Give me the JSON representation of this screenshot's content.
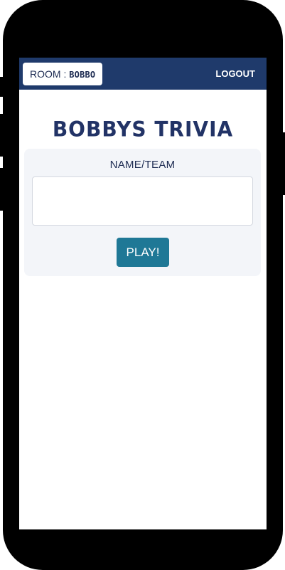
{
  "header": {
    "room_label": "ROOM : ",
    "room_code": "BOBBO",
    "logout_label": "LOGOUT"
  },
  "main": {
    "title": "BOBBYS TRIVIA",
    "name_label": "NAME/TEAM",
    "name_value": "",
    "name_placeholder": "",
    "play_label": "PLAY!"
  },
  "colors": {
    "navbar": "#1f3a6b",
    "title": "#223366",
    "play_button": "#1f7896",
    "card_background": "#f3f5f9"
  }
}
